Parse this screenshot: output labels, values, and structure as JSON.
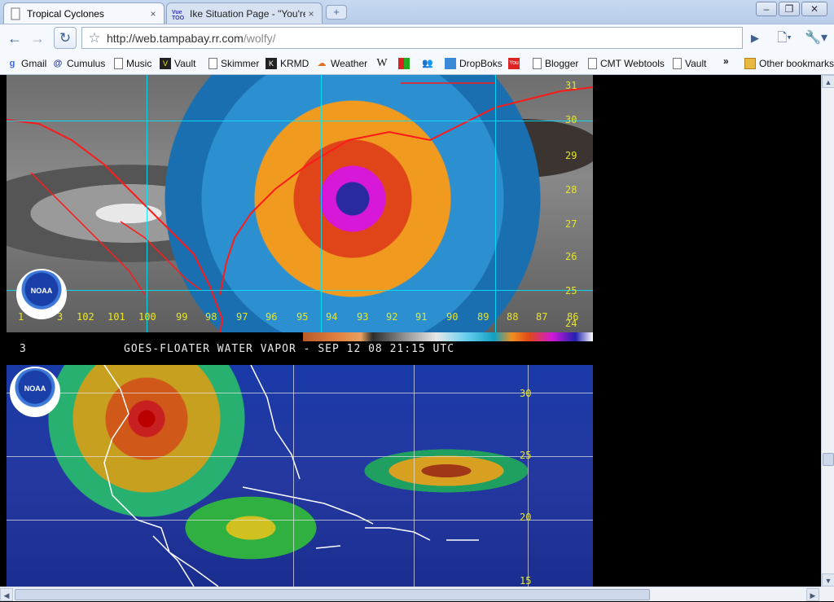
{
  "tabs": [
    {
      "title": "Tropical Cyclones",
      "close": "×"
    },
    {
      "title": "Ike Situation Page - \"You're...",
      "close": "×"
    }
  ],
  "newtab": "+",
  "window_controls": {
    "minimize": "–",
    "maximize": "❐",
    "close": "✕"
  },
  "toolbar": {
    "back": "←",
    "forward": "→",
    "reload": "↻",
    "star": "☆",
    "url_host": "http://web.tampabay.rr.com",
    "url_path": "/wolfy/",
    "go": "▶",
    "page_menu": "🗋▾",
    "wrench_menu": "🔧▾"
  },
  "bookmarks": [
    {
      "label": "Gmail",
      "icon": "g-icon"
    },
    {
      "label": "Cumulus",
      "icon": "swirl-icon"
    },
    {
      "label": "Music",
      "icon": "page-icon"
    },
    {
      "label": "Vault",
      "icon": "vault-icon"
    },
    {
      "label": "Skimmer",
      "icon": "page-icon"
    },
    {
      "label": "KRMD",
      "icon": "krmd-icon"
    },
    {
      "label": "Weather",
      "icon": "weather-icon"
    },
    {
      "label": "",
      "icon": "wikipedia-icon"
    },
    {
      "label": "",
      "icon": "grid-icon"
    },
    {
      "label": "",
      "icon": "people-icon"
    },
    {
      "label": "DropBoks",
      "icon": "box-icon"
    },
    {
      "label": "",
      "icon": "youtube-icon"
    },
    {
      "label": "Blogger",
      "icon": "page-icon"
    },
    {
      "label": "CMT Webtools",
      "icon": "page-icon"
    },
    {
      "label": "Vault",
      "icon": "page-icon"
    },
    {
      "label": "»",
      "icon": ""
    },
    {
      "label": "Other bookmarks",
      "icon": "folder-icon"
    }
  ],
  "sat1": {
    "latitudes": [
      "31",
      "30",
      "29",
      "28",
      "27",
      "26",
      "25",
      "24"
    ],
    "longitudes": [
      "1",
      "3",
      "102",
      "101",
      "100",
      "99",
      "98",
      "97",
      "96",
      "95",
      "94",
      "93",
      "92",
      "91",
      "90",
      "89",
      "88",
      "87",
      "86"
    ],
    "logo": "NOAA"
  },
  "caption": {
    "frame": "3",
    "text": "GOES-FLOATER WATER VAPOR  - SEP 12 08 21:15 UTC"
  },
  "sat2": {
    "latitudes": [
      "30",
      "25",
      "20",
      "15"
    ],
    "logo": "NOAA"
  }
}
